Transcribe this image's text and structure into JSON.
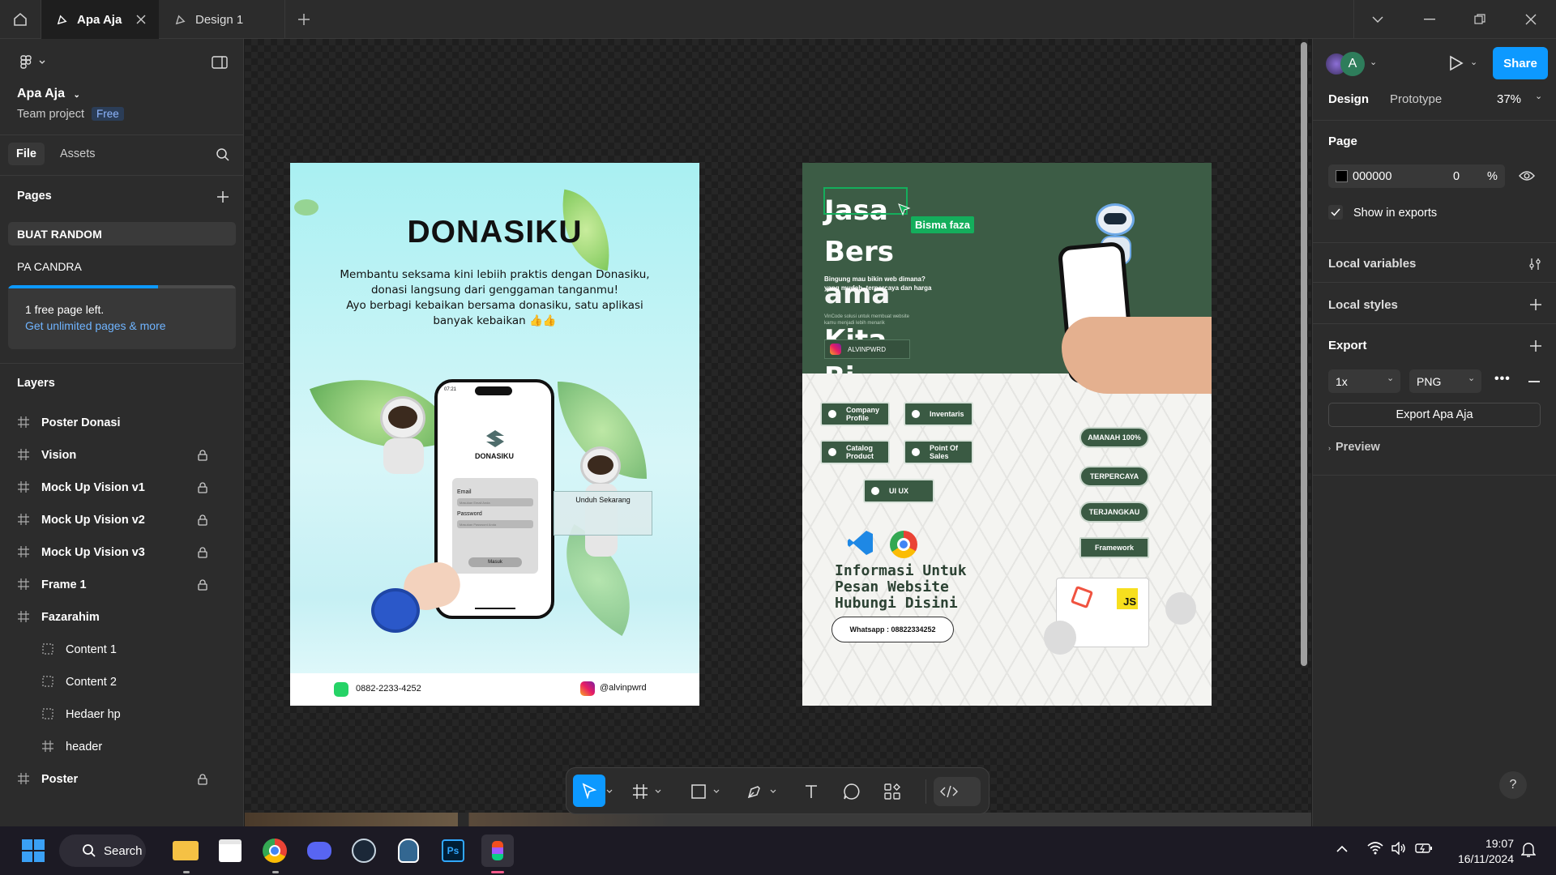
{
  "tabs": [
    {
      "label": "Apa Aja"
    },
    {
      "label": "Design 1"
    }
  ],
  "project": {
    "name": "Apa Aja",
    "team": "Team project",
    "plan": "Free"
  },
  "left_tabs": {
    "file": "File",
    "assets": "Assets"
  },
  "pages": {
    "title": "Pages",
    "items": [
      {
        "label": "BUAT RANDOM"
      },
      {
        "label": "PA CANDRA"
      }
    ],
    "notice": "1 free page left.",
    "upgrade_link": "Get unlimited pages & more"
  },
  "layers": {
    "title": "Layers",
    "items": [
      {
        "label": "Poster Donasi"
      },
      {
        "label": "Vision"
      },
      {
        "label": "Mock Up Vision v1"
      },
      {
        "label": "Mock Up Vision v2"
      },
      {
        "label": "Mock Up Vision v3"
      },
      {
        "label": "Frame 1"
      },
      {
        "label": "Fazarahim"
      },
      {
        "label": "Content 1"
      },
      {
        "label": "Content 2"
      },
      {
        "label": "Hedaer hp"
      },
      {
        "label": "header"
      },
      {
        "label": "Poster"
      }
    ]
  },
  "right": {
    "avatar_initial": "A",
    "share": "Share",
    "tab_design": "Design",
    "tab_prototype": "Prototype",
    "zoom": "37%",
    "page_title": "Page",
    "page_color": "000000",
    "page_opacity": "0",
    "opacity_unit": "%",
    "show_in_exports": "Show in exports",
    "local_variables": "Local variables",
    "local_styles": "Local styles",
    "export": "Export",
    "export_scale": "1x",
    "export_format": "PNG",
    "export_button": "Export Apa Aja",
    "preview": "Preview"
  },
  "poster1": {
    "title": "DONASIKU",
    "desc1": "Membantu seksama kini lebiih praktis dengan Donasiku,",
    "desc2": "donasi langsung dari genggaman tanganmu!",
    "desc3": "Ayo berbagi kebaikan bersama donasiku, satu aplikasi",
    "desc4": "banyak kebaikan 👍👍",
    "phone_time": "07:21",
    "app_name": "DONASIKU",
    "email_label": "Email",
    "email_ph": "Masukan Email Anda",
    "password_label": "Password",
    "password_ph": "Masukan Password Anda",
    "login": "Masuk",
    "download": "Unduh Sekarang",
    "phone": "0882-2233-4252",
    "instagram": "@alvinpwrd"
  },
  "poster2": {
    "word1": "Jasa",
    "word2": "Bers",
    "word3": "ama",
    "word4": "Kita",
    "word5": "Bi",
    "cursor_label": "Bisma faza",
    "sub1": "Bingung mau bikin web dimana?",
    "sub2": "yang mudah, terpercaya dan harga",
    "sub3": "VinCode solusi untuk membuat website",
    "sub4": "kamu menjadi lebih menarik",
    "handle": "ALVINPWRD",
    "services": [
      "Company Profile",
      "Inventaris",
      "Catalog Product",
      "Point Of Sales",
      "UI UX"
    ],
    "features": [
      "AMANAH 100%",
      "TERPERCAYA",
      "TERJANGKAU",
      "Framework"
    ],
    "info1": "Informasi Untuk",
    "info2": "Pesan Website",
    "info3": "Hubungi Disini",
    "whatsapp": "Whatsapp : 08822334252",
    "js": "JS"
  },
  "taskbar": {
    "search": "Search",
    "time": "19:07",
    "date": "16/11/2024"
  },
  "help": "?"
}
